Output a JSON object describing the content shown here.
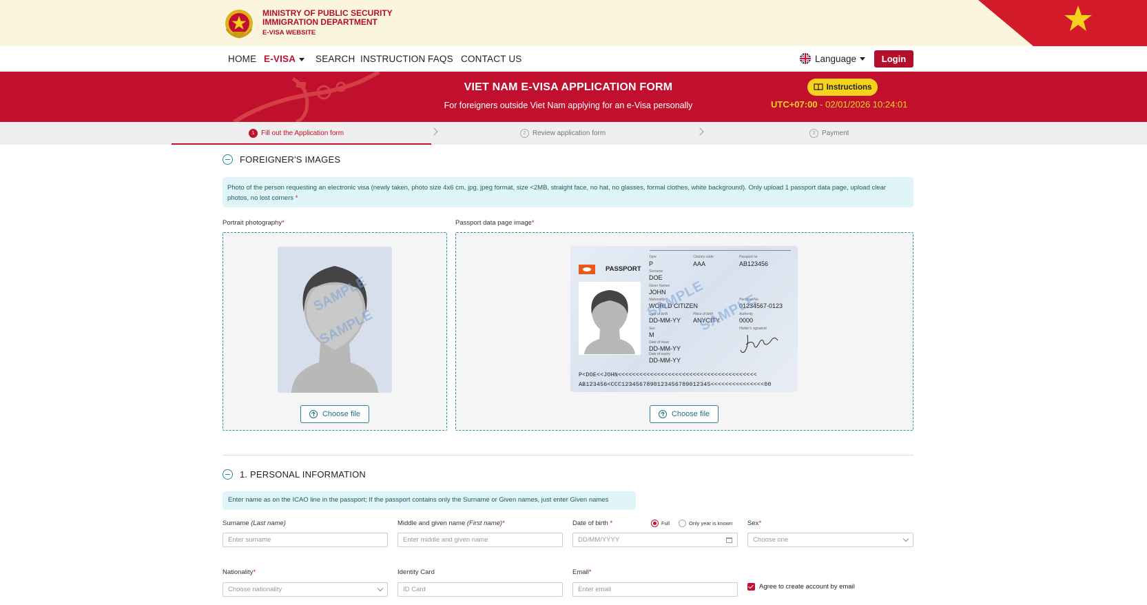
{
  "header": {
    "ministry_line1": "MINISTRY OF PUBLIC SECURITY",
    "ministry_line2": "IMMIGRATION DEPARTMENT",
    "ministry_line3": "E-VISA WEBSITE"
  },
  "nav": {
    "items": [
      {
        "label": "HOME"
      },
      {
        "label": "E-VISA"
      },
      {
        "label": "SEARCH"
      },
      {
        "label": "INSTRUCTION"
      },
      {
        "label": "FAQS"
      },
      {
        "label": "CONTACT US"
      }
    ],
    "language_label": "Language",
    "login_label": "Login"
  },
  "banner": {
    "title": "VIET NAM E-VISA APPLICATION FORM",
    "subtitle": "For foreigners outside Viet Nam applying for an e-Visa personally",
    "instructions_label": "Instructions",
    "timezone": "UTC+07:00",
    "datetime": " - 02/01/2026 10:24:01"
  },
  "stepper": {
    "steps": [
      {
        "num": "1",
        "label": "Fill out the Application form"
      },
      {
        "num": "2",
        "label": "Review application form"
      },
      {
        "num": "3",
        "label": "Payment"
      }
    ]
  },
  "images_section": {
    "title": "FOREIGNER'S IMAGES",
    "note": "Photo of the person requesting an electronic visa (newly taken, photo size 4x6 cm, jpg, jpeg format, size <2MB, straight face, no hat, no glasses, formal clothes, white background). Only upload 1 passport data page, upload clear photos, no lost corners",
    "portrait_label": "Portrait photography",
    "passport_label": "Passport data page image",
    "choose_file": "Choose file",
    "watermark": "SAMPLE"
  },
  "passport_sample": {
    "heading": "PASSPORT",
    "type_label": "Type",
    "type": "P",
    "country_label": "Country code",
    "country": "AAA",
    "number_label": "Passport №",
    "number": "AB123456",
    "surname_label": "Surname",
    "surname": "DOE",
    "given_label": "Given Names",
    "given": "JOHN",
    "nationality_label": "Nationality",
    "nationality": "WORLD CITIZEN",
    "personal_label": "Personal No.",
    "personal": "01234567-0123",
    "dob_label": "Date of birth",
    "dob": "DD-MM-YY",
    "pob_label": "Place of birth",
    "pob": "ANYCITY",
    "authority_label": "Authority",
    "authority": "0000",
    "sex_label": "Sex",
    "sex": "M",
    "signature_label": "Holder's signature",
    "issue_label": "Date of issue",
    "issue": "DD-MM-YY",
    "expiry_label": "Date of expiry",
    "expiry": "DD-MM-YY",
    "mrz1": "P<DOE<<JOHN<<<<<<<<<<<<<<<<<<<<<<<<<<<<<<<<<<<<<<<",
    "mrz2": "AB123456<CCC1234567890123456789012345<<<<<<<<<<<<<<<00"
  },
  "personal_section": {
    "title": "1. PERSONAL INFORMATION",
    "note": "Enter name as on the ICAO line in the passport; If the passport contains only the Surname or Given names, just enter Given names",
    "surname_label": "Surname ",
    "surname_label_italic": "(Last name)",
    "surname_placeholder": "Enter surname",
    "given_label": "Middle and given name ",
    "given_label_italic": "(First name)",
    "given_placeholder": "Enter middle and given name",
    "dob_label": "Date of birth ",
    "dob_placeholder": "DD/MM/YYYY",
    "dob_full": "Full",
    "dob_year_only": "Only year is known",
    "sex_label": "Sex",
    "sex_placeholder": "Choose one",
    "nationality_label": "Nationality",
    "nationality_placeholder": "Choose nationality",
    "id_label": "Identity Card",
    "id_placeholder": "ID Card",
    "email_label": "Email",
    "email_placeholder": "Enter email",
    "agree_label": "Agree to create account by email"
  },
  "colors": {
    "brand_red": "#c0102e",
    "accent_yellow": "#f6d21e",
    "teal": "#1f8a9e"
  }
}
